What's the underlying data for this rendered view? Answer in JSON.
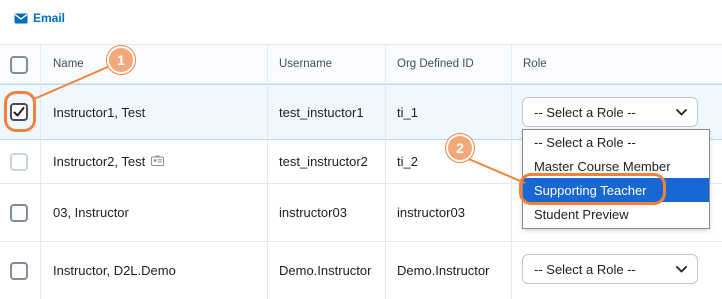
{
  "toolbar": {
    "email_label": "Email"
  },
  "table": {
    "columns": [
      "Name",
      "Username",
      "Org Defined ID",
      "Role"
    ],
    "rows": [
      {
        "name": "Instructor1, Test",
        "username": "test_instuctor1",
        "org_id": "ti_1",
        "role": "-- Select a Role --",
        "checked": true
      },
      {
        "name": "Instructor2, Test",
        "username": "test_instructor2",
        "org_id": "ti_2",
        "role": "",
        "checked": false
      },
      {
        "name": "03, Instructor",
        "username": "instructor03",
        "org_id": "instructor03",
        "role": "",
        "checked": false
      },
      {
        "name": "Instructor, D2L.Demo",
        "username": "Demo.Instructor",
        "org_id": "Demo.Instructor",
        "role": "-- Select a Role --",
        "checked": false
      }
    ]
  },
  "role_dropdown": {
    "options": [
      "-- Select a Role --",
      "Master Course Member",
      "Supporting Teacher",
      "Student Preview"
    ],
    "highlighted": "Supporting Teacher"
  },
  "callouts": [
    "1",
    "2"
  ],
  "colors": {
    "link": "#006fbf",
    "highlight": "#1967d2",
    "callout": "#f0823b",
    "selected_row": "#f0f8ff"
  },
  "icons": [
    "envelope-icon",
    "checkmark-icon",
    "chevron-down-icon",
    "user-card-icon"
  ]
}
